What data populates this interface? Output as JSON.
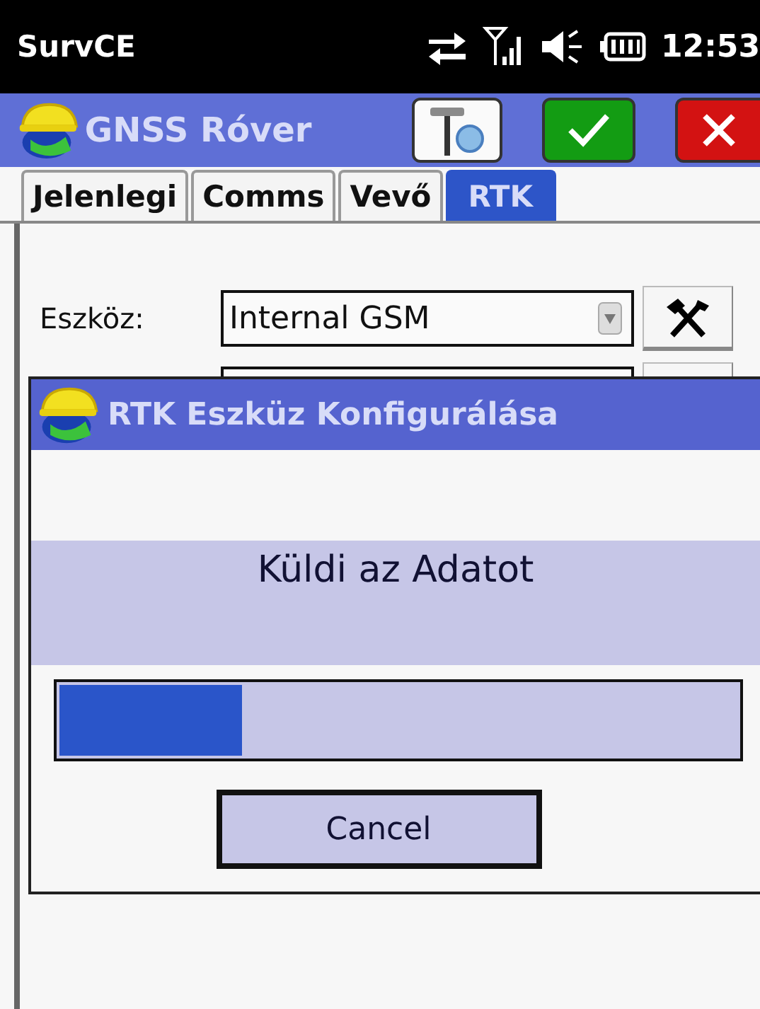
{
  "status_bar": {
    "app": "SurvCE",
    "time": "12:53"
  },
  "window": {
    "title": "GNSS Róver"
  },
  "tabs": [
    {
      "label": "Jelenlegi",
      "selected": false
    },
    {
      "label": "Comms",
      "selected": false
    },
    {
      "label": "Vevő",
      "selected": false
    },
    {
      "label": "RTK",
      "selected": true
    }
  ],
  "fields": [
    {
      "label": "Eszköz:",
      "value": "Internal GSM"
    }
  ],
  "dialog": {
    "title": "RTK Eszküz Konfigurálása",
    "message": "Küldi az Adatot",
    "progress": {
      "level": 0.27
    },
    "button": "Cancel"
  }
}
